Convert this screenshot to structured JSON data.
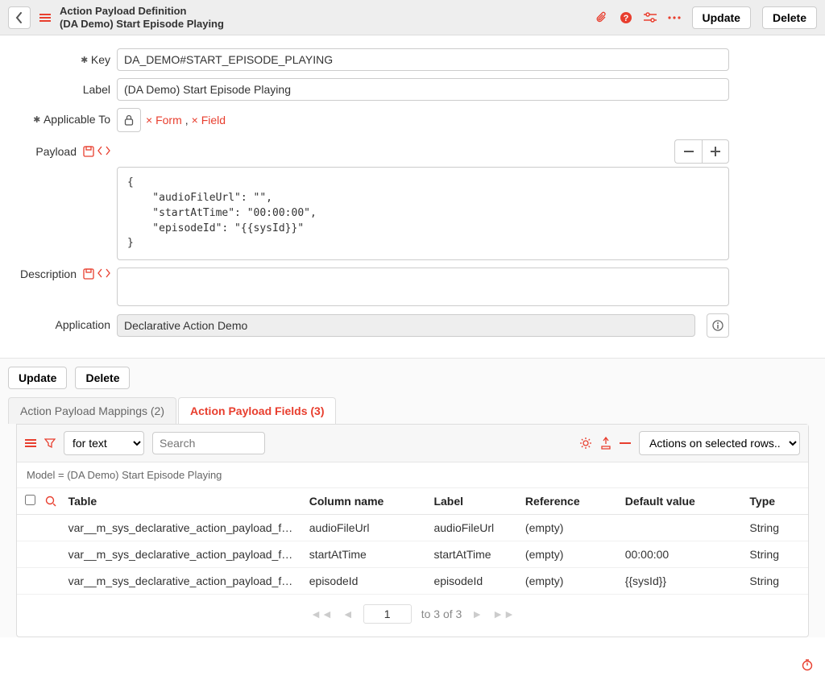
{
  "header": {
    "title": "Action Payload Definition",
    "subtitle": "(DA Demo) Start Episode Playing",
    "update_label": "Update",
    "delete_label": "Delete"
  },
  "form": {
    "key_label": "Key",
    "key_value": "DA_DEMO#START_EPISODE_PLAYING",
    "label_label": "Label",
    "label_value": "(DA Demo) Start Episode Playing",
    "applicable_label": "Applicable To",
    "applicable_tags": [
      {
        "prefix": "×",
        "name": "Form"
      },
      {
        "prefix": "×",
        "name": "Field"
      }
    ],
    "payload_label": "Payload",
    "payload_value": "{\n    \"audioFileUrl\": \"\",\n    \"startAtTime\": \"00:00:00\",\n    \"episodeId\": \"{{sysId}}\"\n}",
    "description_label": "Description",
    "description_value": "",
    "application_label": "Application",
    "application_value": "Declarative Action Demo"
  },
  "mid": {
    "update_label": "Update",
    "delete_label": "Delete"
  },
  "tabs": [
    {
      "label": "Action Payload Mappings (2)",
      "active": false
    },
    {
      "label": "Action Payload Fields (3)",
      "active": true
    }
  ],
  "list": {
    "filter_type": "for text",
    "search_placeholder": "Search",
    "actions_placeholder": "Actions on selected rows...",
    "breadcrumb": "Model = (DA Demo) Start Episode Playing",
    "columns": [
      "Table",
      "Column name",
      "Label",
      "Reference",
      "Default value",
      "Type"
    ],
    "rows": [
      {
        "table": "var__m_sys_declarative_action_payload_fi...",
        "column": "audioFileUrl",
        "label": "audioFileUrl",
        "reference": "(empty)",
        "default": "",
        "type": "String"
      },
      {
        "table": "var__m_sys_declarative_action_payload_fi...",
        "column": "startAtTime",
        "label": "startAtTime",
        "reference": "(empty)",
        "default": "00:00:00",
        "type": "String"
      },
      {
        "table": "var__m_sys_declarative_action_payload_fi...",
        "column": "episodeId",
        "label": "episodeId",
        "reference": "(empty)",
        "default": "{{sysId}}",
        "type": "String"
      }
    ],
    "pager": {
      "page": "1",
      "of_text": "to 3 of 3"
    }
  }
}
